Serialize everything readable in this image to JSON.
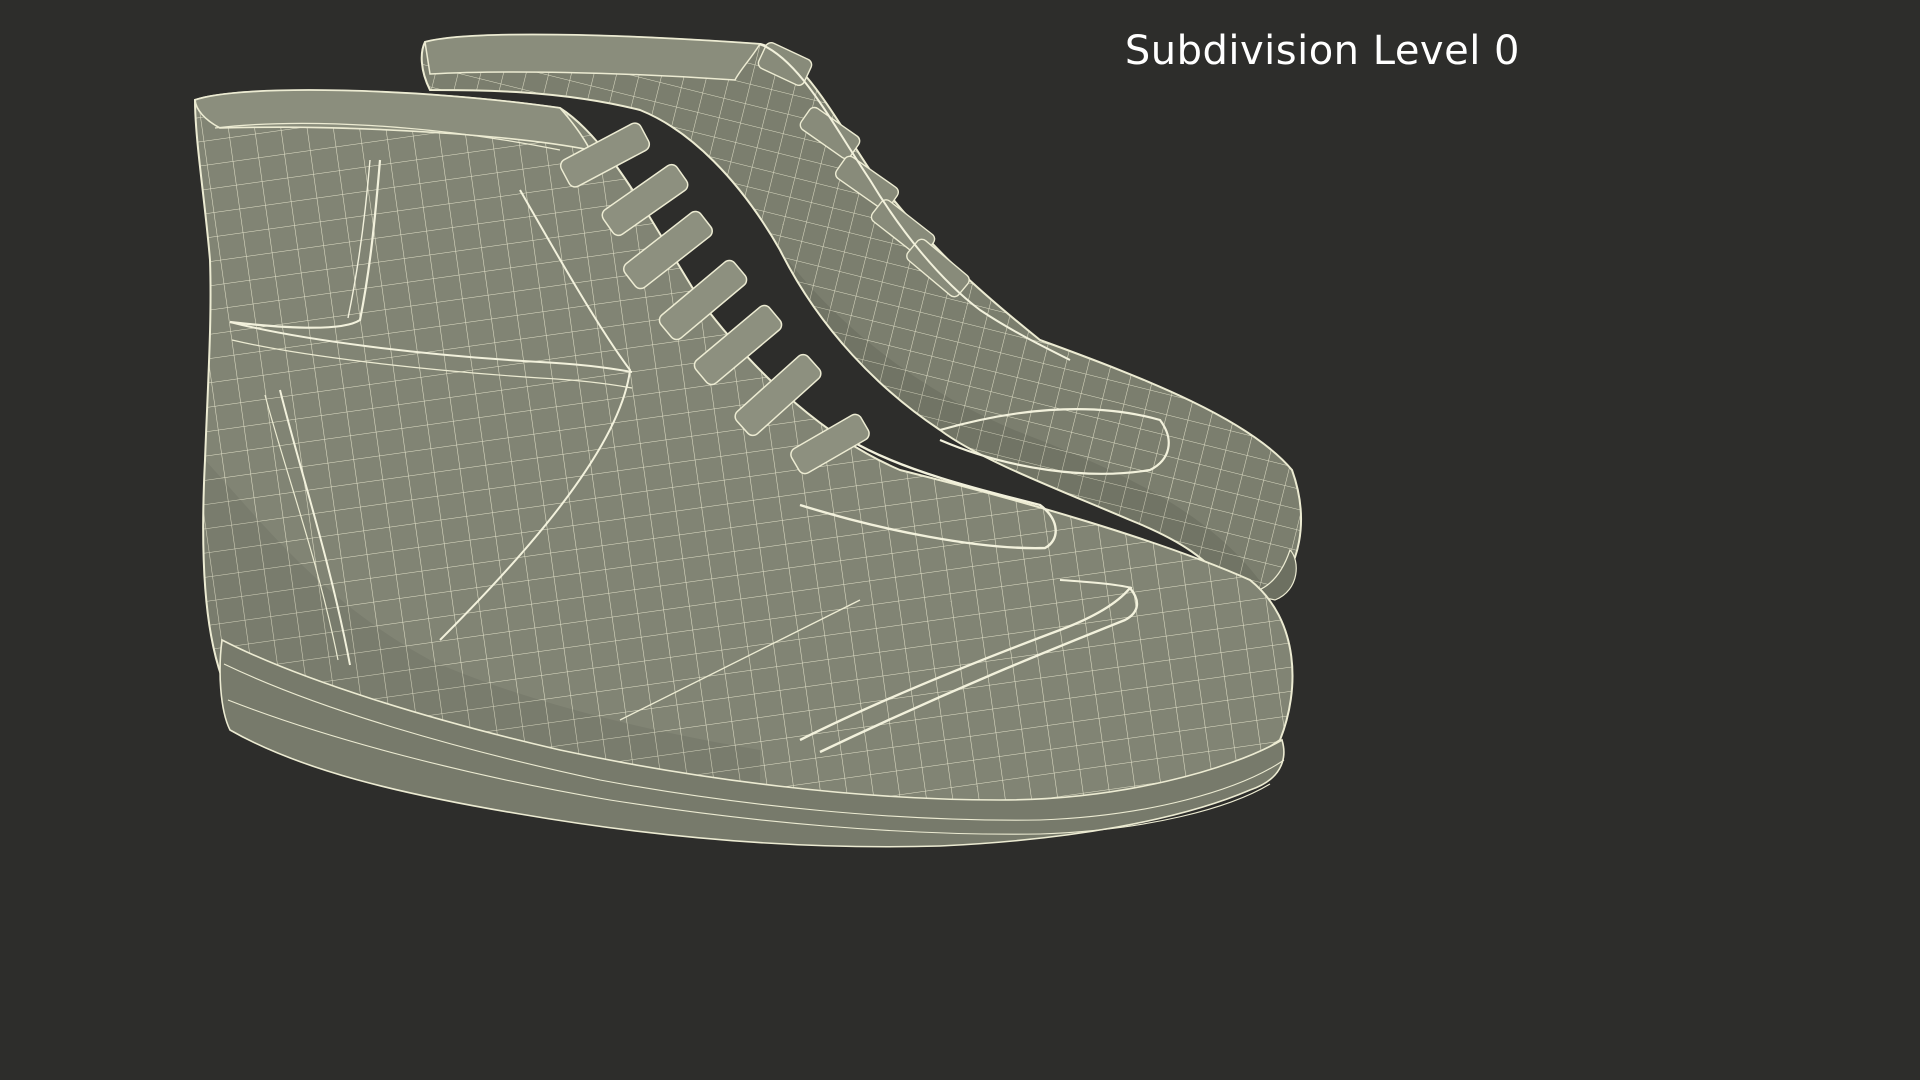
{
  "overlay": {
    "label": "Subdivision Level 0"
  },
  "scene": {
    "subject": "pair of high-top sneakers, wireframe mesh",
    "background_color": "#2d2d2b",
    "mesh_fill_color": "#7f8272",
    "wire_color": "#ecebd2"
  }
}
